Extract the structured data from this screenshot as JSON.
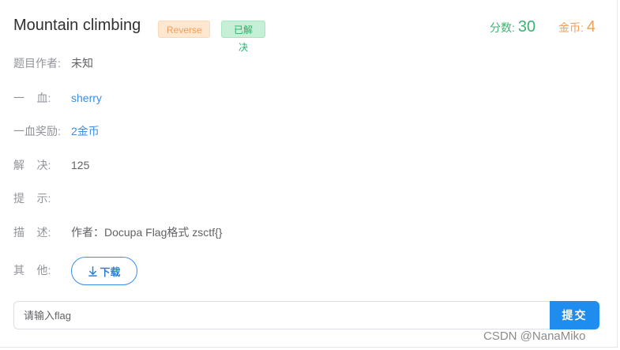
{
  "challenge": {
    "title": "Mountain climbing",
    "category": "Reverse",
    "status": "已解决",
    "score_label": "分数:",
    "score_value": "30",
    "gold_label": "金币:",
    "gold_value": "4"
  },
  "details": [
    {
      "label": "题目作者:",
      "value": "未知"
    },
    {
      "label": "一    血:",
      "value": "sherry"
    },
    {
      "label": "一血奖励:",
      "value": "2金币"
    },
    {
      "label": "解    决:",
      "value": "125"
    },
    {
      "label": "提    示:",
      "value": ""
    },
    {
      "label": "描    述:",
      "value": "作者：Docupa Flag格式 zsctf{}"
    },
    {
      "label": "其    他:",
      "value": ""
    }
  ],
  "download": {
    "label": "下载",
    "icon": "download-arrow-icon"
  },
  "flag": {
    "placeholder": "请输入flag",
    "submit_label": "提交"
  },
  "watermark": "CSDN @NanaMiko",
  "colors": {
    "accent": "#1f8cf0",
    "link": "#3a8ee6",
    "score": "#3cb46f",
    "gold": "#f0a05a"
  }
}
